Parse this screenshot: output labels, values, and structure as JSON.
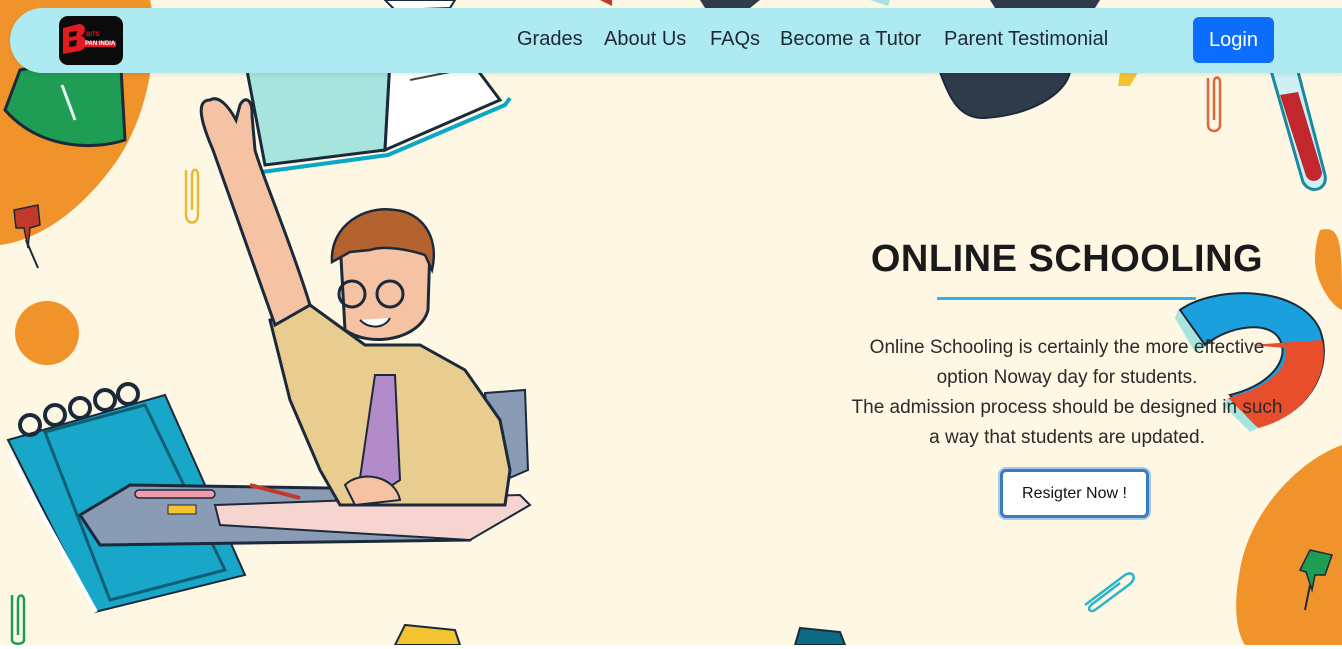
{
  "brand": {
    "logo_line1": "BITS",
    "logo_line2": "PAN INDIA",
    "logo_letter": "B"
  },
  "nav": {
    "items": [
      {
        "label": "Grades"
      },
      {
        "label": "About Us"
      },
      {
        "label": "FAQs"
      },
      {
        "label": "Become a Tutor"
      },
      {
        "label": "Parent Testimonial"
      }
    ],
    "login_label": "Login"
  },
  "hero": {
    "title": "ONLINE SCHOOLING",
    "description_lines": [
      "Online Schooling is certainly the more effective",
      "option Noway day for students.",
      "The admission process should be designed in such",
      "a way that students are updated."
    ],
    "register_label": "Resigter Now !"
  },
  "colors": {
    "navbar_bg": "#aeeaf2",
    "login_bg": "#0d6efd",
    "accent_underline": "#2ab6e6",
    "page_bg": "#fdf7e3",
    "orange_blob": "#f0932b"
  },
  "illustration": {
    "icons": [
      "student-raising-hand-icon",
      "spiral-notebook-icon",
      "open-book-icon",
      "graduation-cap-icon",
      "test-tube-icon",
      "flask-icon",
      "magnet-icon",
      "paperclip-icon",
      "push-pin-icon",
      "pencil-icon"
    ]
  }
}
